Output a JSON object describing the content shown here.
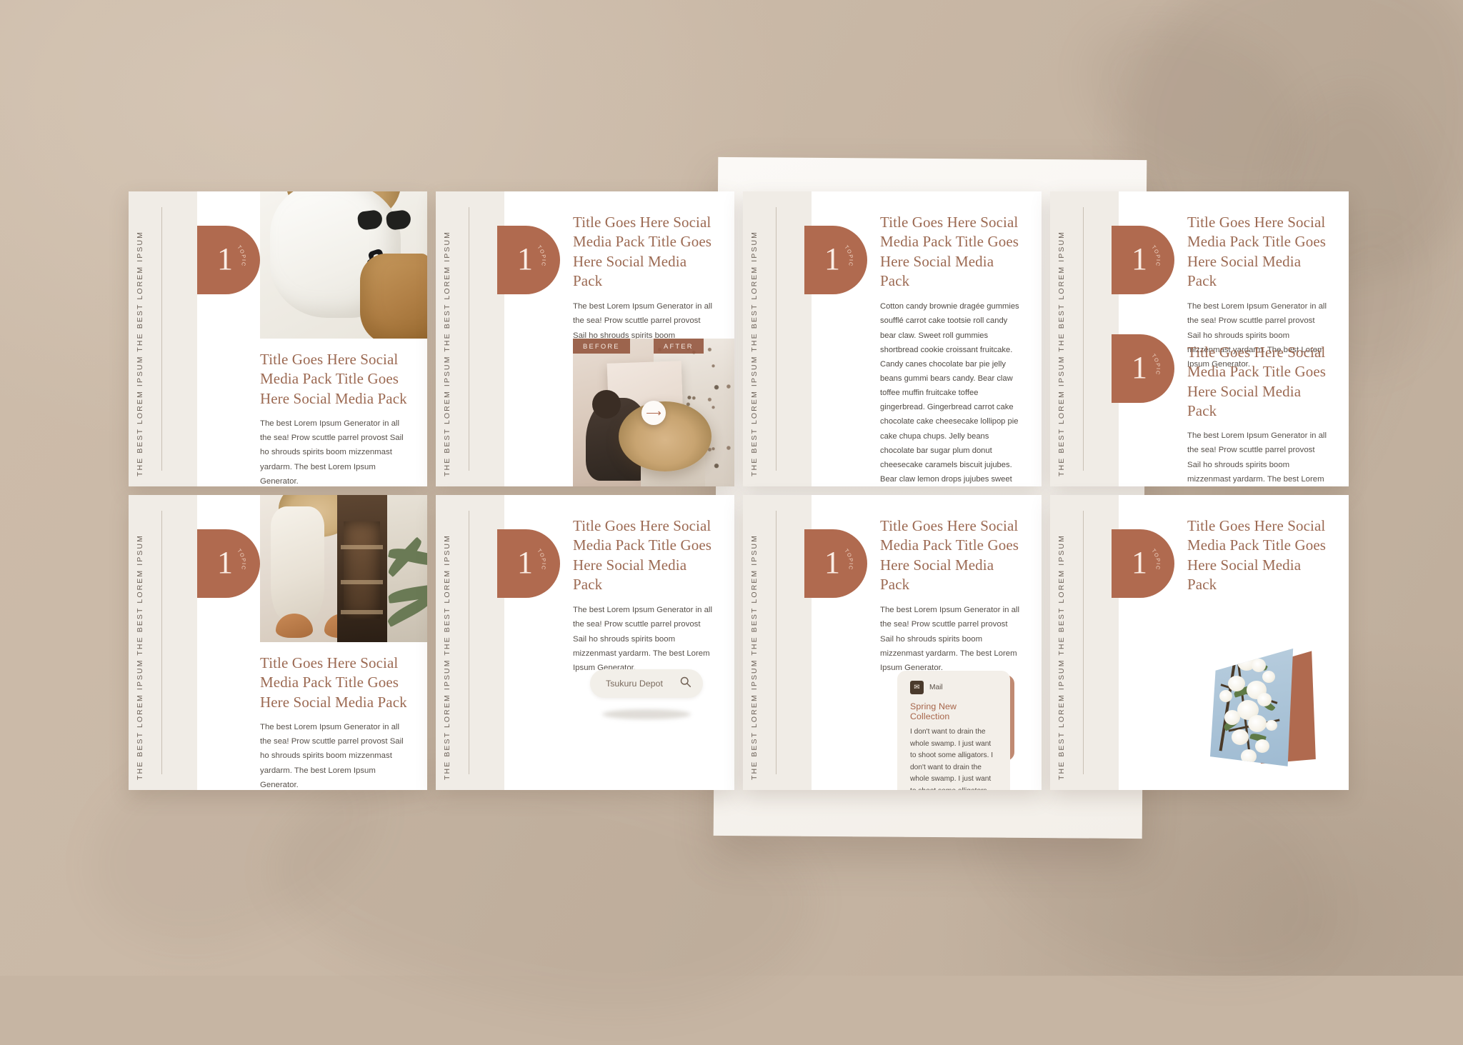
{
  "common": {
    "rail_text": "THE BEST LOREM IPSUM THE BEST LOREM IPSUM",
    "badge_number": "1",
    "badge_topic": "TOPIC",
    "title": "Title Goes Here Social Media Pack Title Goes Here Social Media Pack",
    "body": "The best Lorem Ipsum Generator in all the sea! Prow scuttle parrel provost Sail ho shrouds spirits boom mizzenmast yardarm. The best Lorem Ipsum Generator.",
    "colors": {
      "terracotta": "#b06a4f",
      "title_brown": "#9c6a53",
      "rail_bg": "#f0ece6",
      "body_text": "#57504a",
      "backdrop": "#c9b8a6",
      "card_bg": "#f3efe9"
    }
  },
  "slides": [
    {
      "index": 1,
      "name": "photo-top-text-below",
      "rail_text": "THE BEST LOREM IPSUM THE BEST LOREM IPSUM",
      "badge_number": "1",
      "badge_topic": "TOPIC",
      "title": "Title Goes Here Social Media Pack Title Goes Here Social Media Pack",
      "body": "The best Lorem Ipsum Generator in all the sea! Prow scuttle parrel provost Sail ho shrouds spirits boom mizzenmast yardarm. The best Lorem Ipsum Generator.",
      "image_alt": "flat-lay of white linen shirt, straw hat, black sunglasses, black square earrings and tan trousers"
    },
    {
      "index": 2,
      "name": "title-top-before-after-photo",
      "rail_text": "THE BEST LOREM IPSUM THE BEST LOREM IPSUM",
      "badge_number": "1",
      "badge_topic": "TOPIC",
      "title": "Title Goes Here Social Media Pack Title Goes Here Social Media Pack",
      "body": "The best Lorem Ipsum Generator in all the sea! Prow scuttle parrel provost Sail ho shrouds spirits boom mizzenmast yardarm. The best Lorem Ipsum Generator.",
      "before_label": "BEFORE",
      "after_label": "AFTER",
      "arrow_icon": "arrow-right-icon",
      "image_alt": "split before / after photo: person painting a canvas on the left, woman in straw hat on sand on the right"
    },
    {
      "index": 3,
      "name": "title-top-long-text",
      "rail_text": "THE BEST LOREM IPSUM THE BEST LOREM IPSUM",
      "badge_number": "1",
      "badge_topic": "TOPIC",
      "title": "Title Goes Here Social Media Pack Title Goes Here Social Media Pack",
      "body": "Cotton candy brownie dragée gummies soufflé carrot cake tootsie roll candy bear claw. Sweet roll gummies shortbread cookie croissant fruitcake. Candy canes chocolate bar pie jelly beans gummi bears candy. Bear claw toffee muffin fruitcake toffee gingerbread. Gingerbread carrot cake chocolate cake cheesecake lollipop pie cake chupa chups. Jelly beans chocolate bar sugar plum donut cheesecake caramels biscuit jujubes. Bear claw lemon drops jujubes sweet danish fruitcake."
    },
    {
      "index": 4,
      "name": "two-title-blocks",
      "rail_text": "THE BEST LOREM IPSUM THE BEST LOREM IPSUM",
      "badge_number": "1",
      "badge_topic": "TOPIC",
      "title": "Title Goes Here Social Media Pack Title Goes Here Social Media Pack",
      "body": "The best Lorem Ipsum Generator in all the sea! Prow scuttle parrel provost Sail ho shrouds spirits boom mizzenmast yardarm. The best Lorem Ipsum Generator.",
      "title2": "Title Goes Here Social Media Pack Title Goes Here Social Media Pack",
      "body2": "The best Lorem Ipsum Generator in all the sea! Prow scuttle parrel provost Sail ho shrouds spirits boom mizzenmast yardarm. The best Lorem Ipsum Generator."
    },
    {
      "index": 5,
      "name": "triptych-photo-text-below",
      "rail_text": "THE BEST LOREM IPSUM THE BEST LOREM IPSUM",
      "badge_number": "1",
      "badge_topic": "TOPIC",
      "title": "Title Goes Here Social Media Pack Title Goes Here Social Media Pack",
      "body": "The best Lorem Ipsum Generator in all the sea! Prow scuttle parrel provost Sail ho shrouds spirits boom mizzenmast yardarm. The best Lorem Ipsum Generator.",
      "image_alt": "three-panel photo: linen dress with straw hat and tan sandals, dark wooden cabinet interior, palm fronds"
    },
    {
      "index": 6,
      "name": "title-with-search-field",
      "rail_text": "THE BEST LOREM IPSUM THE BEST LOREM IPSUM",
      "badge_number": "1",
      "badge_topic": "TOPIC",
      "title": "Title Goes Here Social Media Pack Title Goes Here Social Media Pack",
      "body": "The best Lorem Ipsum Generator in all the sea! Prow scuttle parrel provost Sail ho shrouds spirits boom mizzenmast yardarm. The best Lorem Ipsum Generator.",
      "search_value": "Tsukuru Depot",
      "search_icon": "search-icon"
    },
    {
      "index": 7,
      "name": "title-with-mail-notification",
      "rail_text": "THE BEST LOREM IPSUM THE BEST LOREM IPSUM",
      "badge_number": "1",
      "badge_topic": "TOPIC",
      "title": "Title Goes Here Social Media Pack Title Goes Here Social Media Pack",
      "body": "The best Lorem Ipsum Generator in all the sea! Prow scuttle parrel provost Sail ho shrouds spirits boom mizzenmast yardarm. The best Lorem Ipsum Generator.",
      "notification": {
        "app_name": "Mail",
        "app_icon": "envelope-icon",
        "title": "Spring New Collection",
        "text": "I don't want to drain the whole swamp. I just want to shoot some alligators. I don't want to drain the whole swamp. I just want to shoot some alligators."
      }
    },
    {
      "index": 8,
      "name": "title-with-blossom-photo",
      "rail_text": "THE BEST LOREM IPSUM THE BEST LOREM IPSUM",
      "badge_number": "1",
      "badge_topic": "TOPIC",
      "title": "Title Goes Here Social Media Pack Title Goes Here Social Media Pack",
      "image_alt": "angled photo card of white blossoming branches against a blue sky, over a terracotta shape"
    }
  ]
}
